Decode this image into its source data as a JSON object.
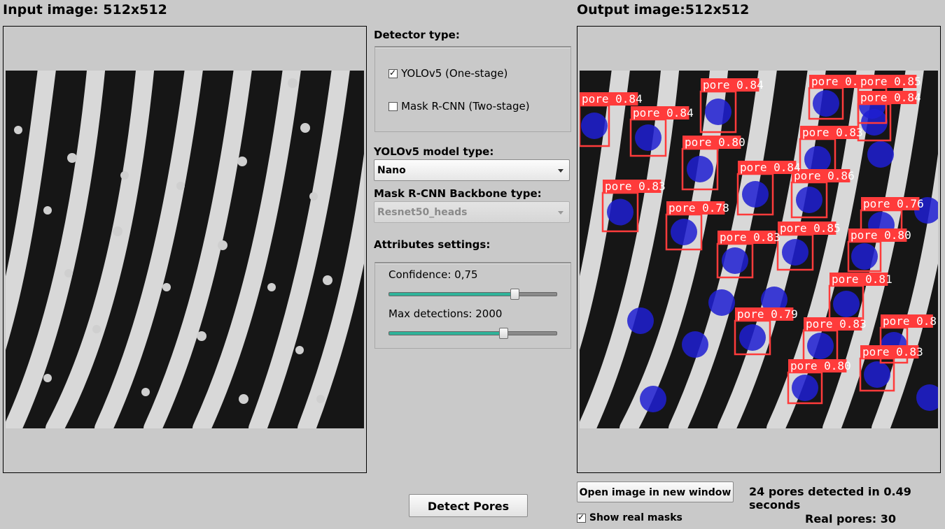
{
  "input_panel": {
    "title": "Input image: 512x512"
  },
  "output_panel": {
    "title": "Output image:512x512"
  },
  "detector": {
    "label": "Detector type:",
    "options": [
      {
        "label": "YOLOv5 (One-stage)",
        "checked": true
      },
      {
        "label": "Mask R-CNN (Two-stage)",
        "checked": false
      }
    ]
  },
  "yolo_model": {
    "label": "YOLOv5 model type:",
    "value": "Nano"
  },
  "mask_backbone": {
    "label": "Mask R-CNN Backbone type:",
    "value": "Resnet50_heads"
  },
  "attributes": {
    "label": "Attributes settings:",
    "confidence_label": "Confidence: 0,75",
    "confidence_value": 0.75,
    "max_detections_label": "Max detections: 2000",
    "max_detections_fraction": 0.68
  },
  "actions": {
    "detect_button": "Detect Pores",
    "open_window_button": "Open image in new window",
    "show_masks_label": "Show real masks",
    "show_masks_checked": true
  },
  "results": {
    "summary": "24 pores detected in 0.49 seconds",
    "real_pores": "Real pores: 30"
  },
  "detections": [
    "pore 0.84",
    "pore 0.84",
    "pore 0.84",
    "pore 0.86",
    "pore 0.85",
    "pore 0.84",
    "pore 0.83",
    "pore 0.80",
    "pore 0.83",
    "pore 0.86",
    "pore 0.78",
    "pore 0.76",
    "pore 0.85",
    "pore 0.83",
    "pore 0.80",
    "pore 0.81",
    "pore 0.79",
    "pore 0.83",
    "pore 0.8",
    "pore 0.80",
    "pore 0.83",
    "pore 0.84"
  ],
  "colors": {
    "accent": "#2fb39a",
    "box": "#ff3b3b",
    "mask": "#1e1ed2"
  },
  "icons": {
    "dropdown": "chevron-down-icon",
    "check": "check-icon"
  }
}
